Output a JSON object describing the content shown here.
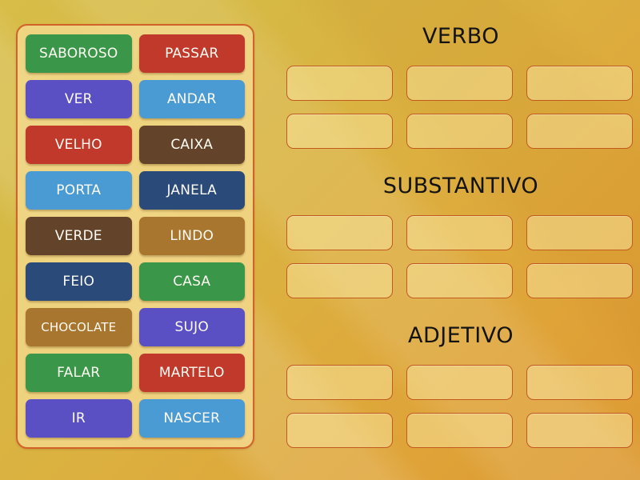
{
  "background": {
    "gradient_from": "#d8bd49",
    "gradient_to": "#dd9a33"
  },
  "word_panel": {
    "border_color": "#d1622a",
    "fill_color": "rgba(246,222,150,0.72)",
    "rows": [
      [
        {
          "label": "SABOROSO",
          "color": "#3a9648"
        },
        {
          "label": "PASSAR",
          "color": "#c0392b"
        }
      ],
      [
        {
          "label": "VER",
          "color": "#5b4fc4"
        },
        {
          "label": "ANDAR",
          "color": "#4a9ad4"
        }
      ],
      [
        {
          "label": "VELHO",
          "color": "#c0392b"
        },
        {
          "label": "CAIXA",
          "color": "#63442a"
        }
      ],
      [
        {
          "label": "PORTA",
          "color": "#4a9ad4"
        },
        {
          "label": "JANELA",
          "color": "#2a4a7a"
        }
      ],
      [
        {
          "label": "VERDE",
          "color": "#63442a"
        },
        {
          "label": "LINDO",
          "color": "#a8762e"
        }
      ],
      [
        {
          "label": "FEIO",
          "color": "#2a4a7a"
        },
        {
          "label": "CASA",
          "color": "#3a9648"
        }
      ],
      [
        {
          "label": "CHOCOLATE",
          "color": "#a8762e",
          "small": true
        },
        {
          "label": "SUJO",
          "color": "#5b4fc4"
        }
      ],
      [
        {
          "label": "FALAR",
          "color": "#3a9648"
        },
        {
          "label": "MARTELO",
          "color": "#c0392b"
        }
      ],
      [
        {
          "label": "IR",
          "color": "#5b4fc4"
        },
        {
          "label": "NASCER",
          "color": "#4a9ad4"
        }
      ]
    ]
  },
  "categories": [
    {
      "title": "VERBO",
      "slot_count": 6
    },
    {
      "title": "SUBSTANTIVO",
      "slot_count": 6
    },
    {
      "title": "ADJETIVO",
      "slot_count": 6
    }
  ]
}
